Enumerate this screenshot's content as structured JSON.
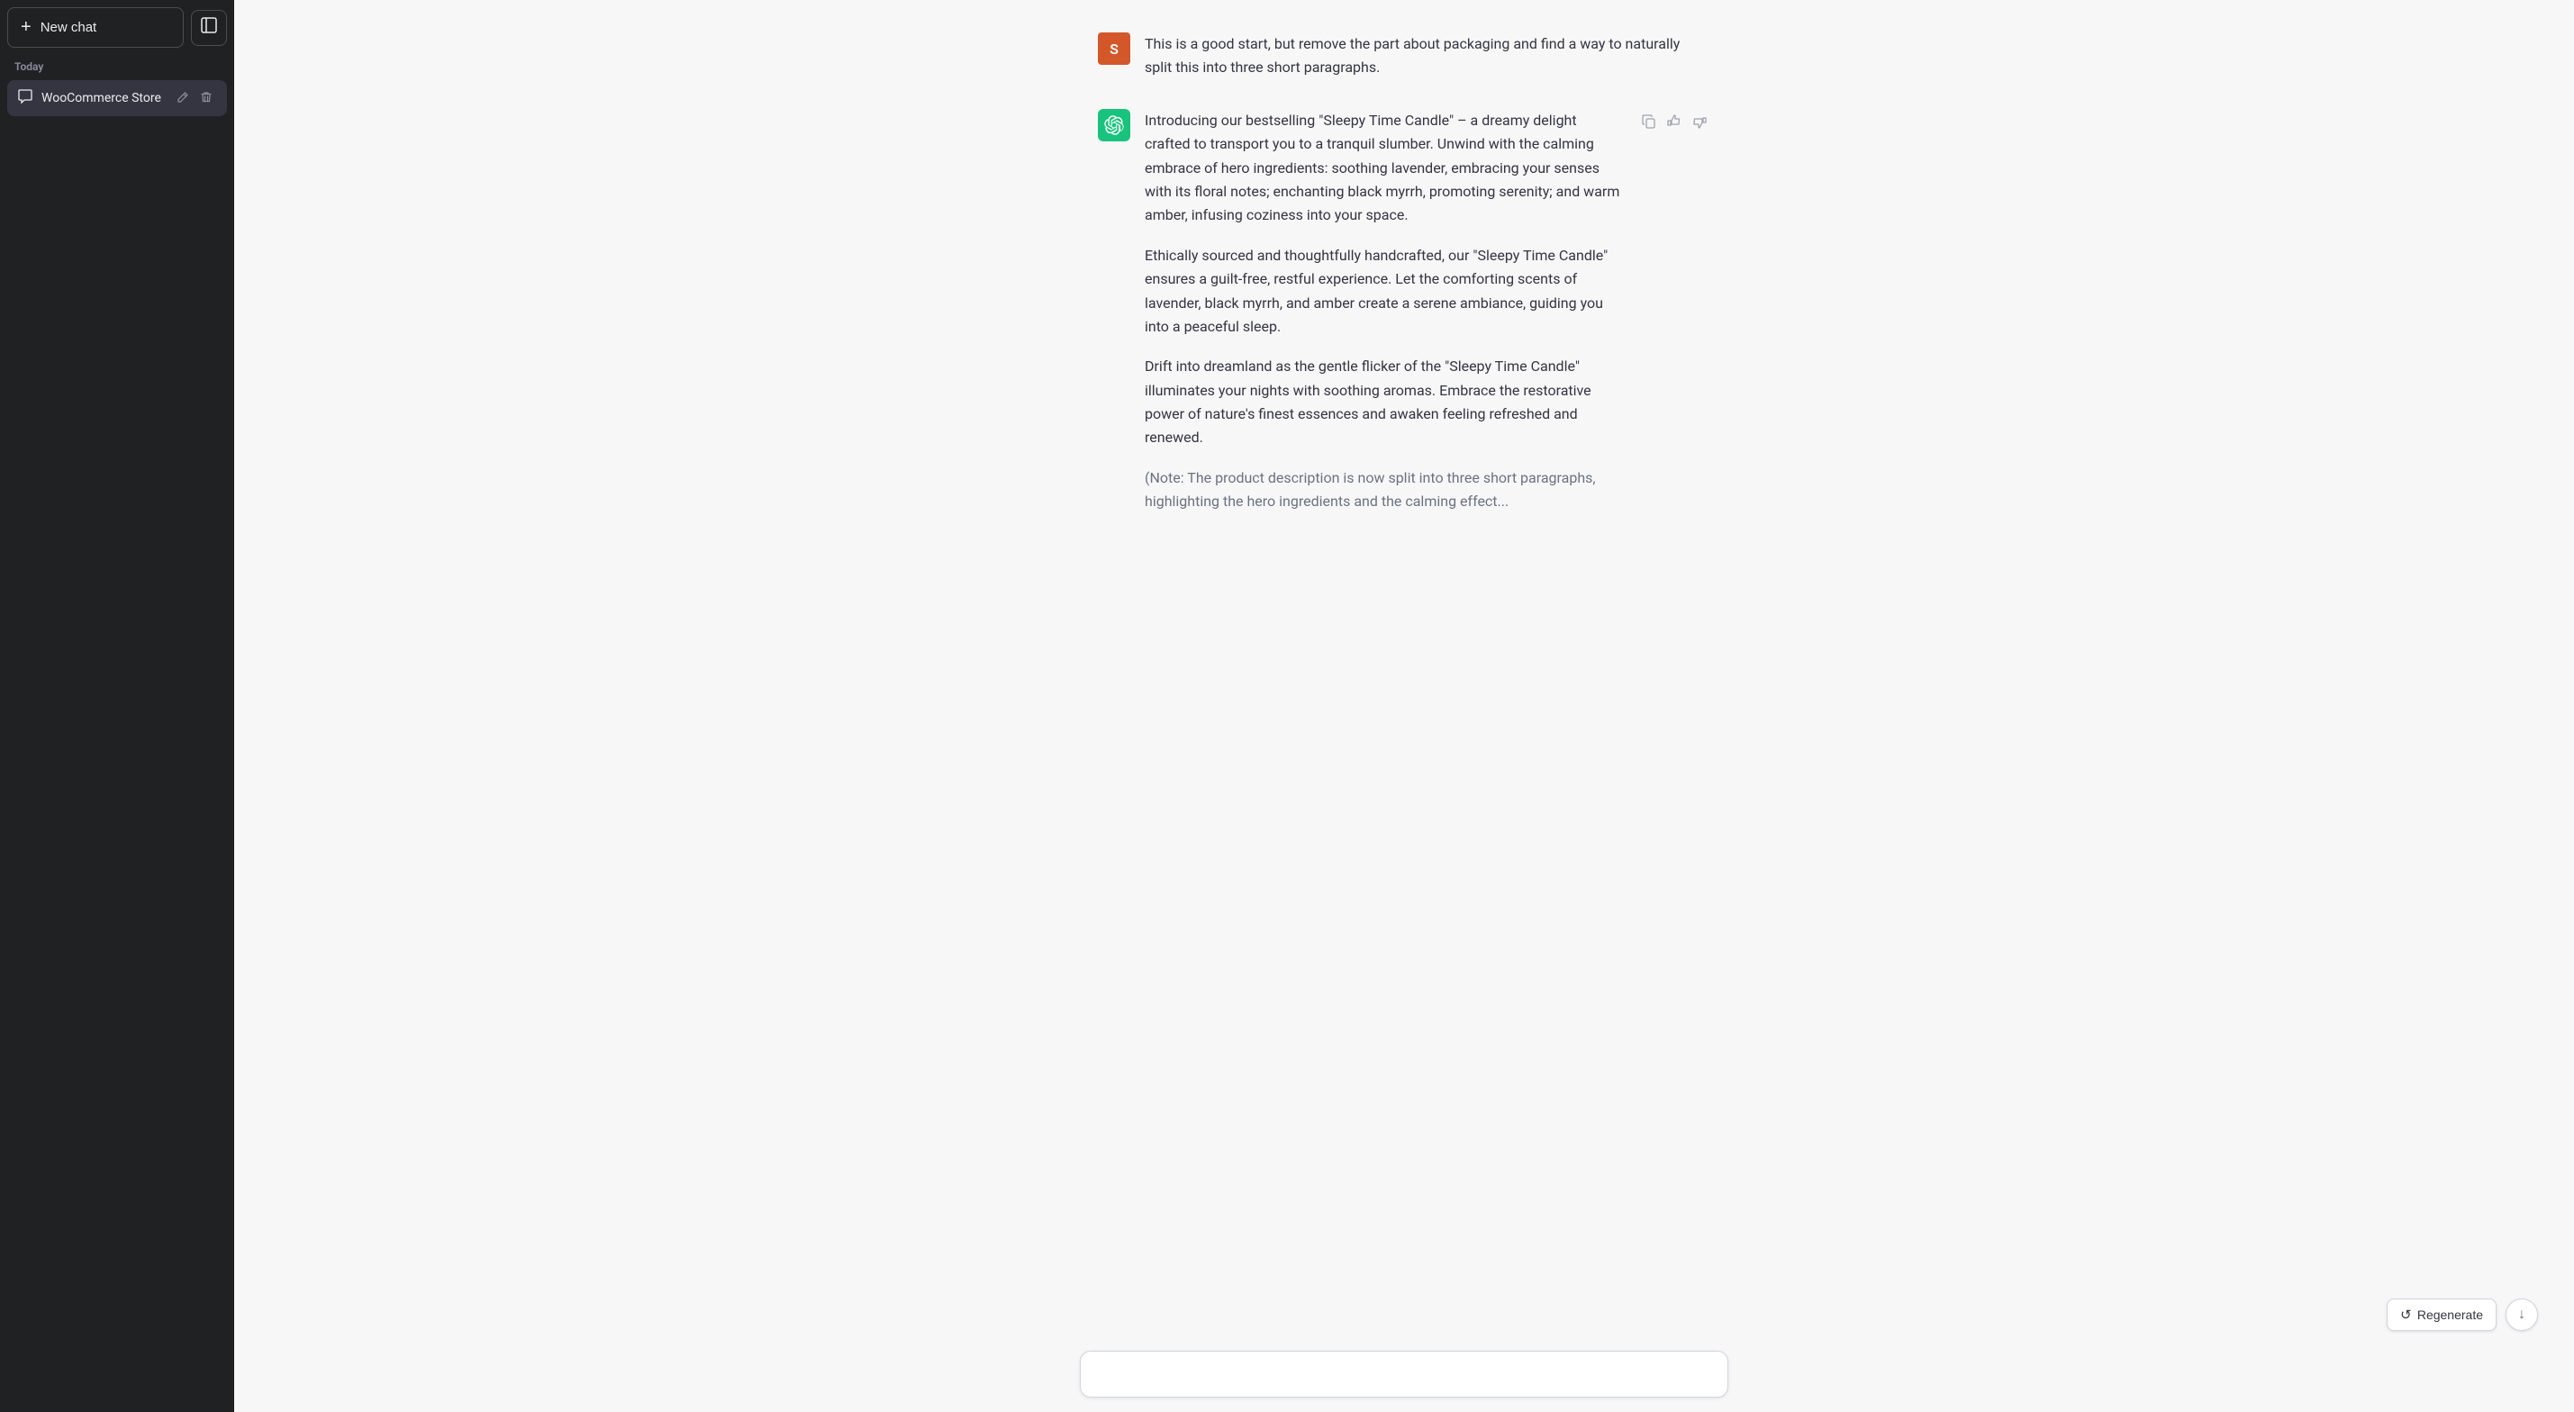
{
  "sidebar": {
    "new_chat_label": "New chat",
    "new_chat_icon": "+",
    "toggle_icon": "⊡",
    "section_today": "Today",
    "history": [
      {
        "id": "woocommerce-store",
        "label": "WooCommerce Store",
        "icon": "💬",
        "active": true
      }
    ]
  },
  "messages": [
    {
      "id": "user-msg-1",
      "role": "user",
      "avatar_letter": "S",
      "content_paragraphs": [
        "This is a good start, but remove the part about packaging and find a way to naturally split this into three short paragraphs."
      ]
    },
    {
      "id": "assistant-msg-1",
      "role": "assistant",
      "content_paragraphs": [
        "Introducing our bestselling \"Sleepy Time Candle\" – a dreamy delight crafted to transport you to a tranquil slumber. Unwind with the calming embrace of hero ingredients: soothing lavender, embracing your senses with its floral notes; enchanting black myrrh, promoting serenity; and warm amber, infusing coziness into your space.",
        "Ethically sourced and thoughtfully handcrafted, our \"Sleepy Time Candle\" ensures a guilt-free, restful experience. Let the comforting scents of lavender, black myrrh, and amber create a serene ambiance, guiding you into a peaceful sleep.",
        "Drift into dreamland as the gentle flicker of the \"Sleepy Time Candle\" illuminates your nights with soothing aromas. Embrace the restorative power of nature's finest essences and awaken feeling refreshed and renewed.",
        "(Note: The product description is now split into three short paragraphs, highlighting the hero ingredients and the calming effect..."
      ],
      "show_actions": true
    }
  ],
  "actions": {
    "copy_icon": "⧉",
    "thumbs_up_icon": "👍",
    "thumbs_down_icon": "👎"
  },
  "floating": {
    "regenerate_label": "Regenerate",
    "regenerate_icon": "↻",
    "scroll_down_icon": "↓"
  },
  "colors": {
    "sidebar_bg": "#202123",
    "user_avatar_bg": "#d4572a",
    "assistant_avatar_bg": "#19c37d",
    "active_chat_bg": "#343541"
  }
}
